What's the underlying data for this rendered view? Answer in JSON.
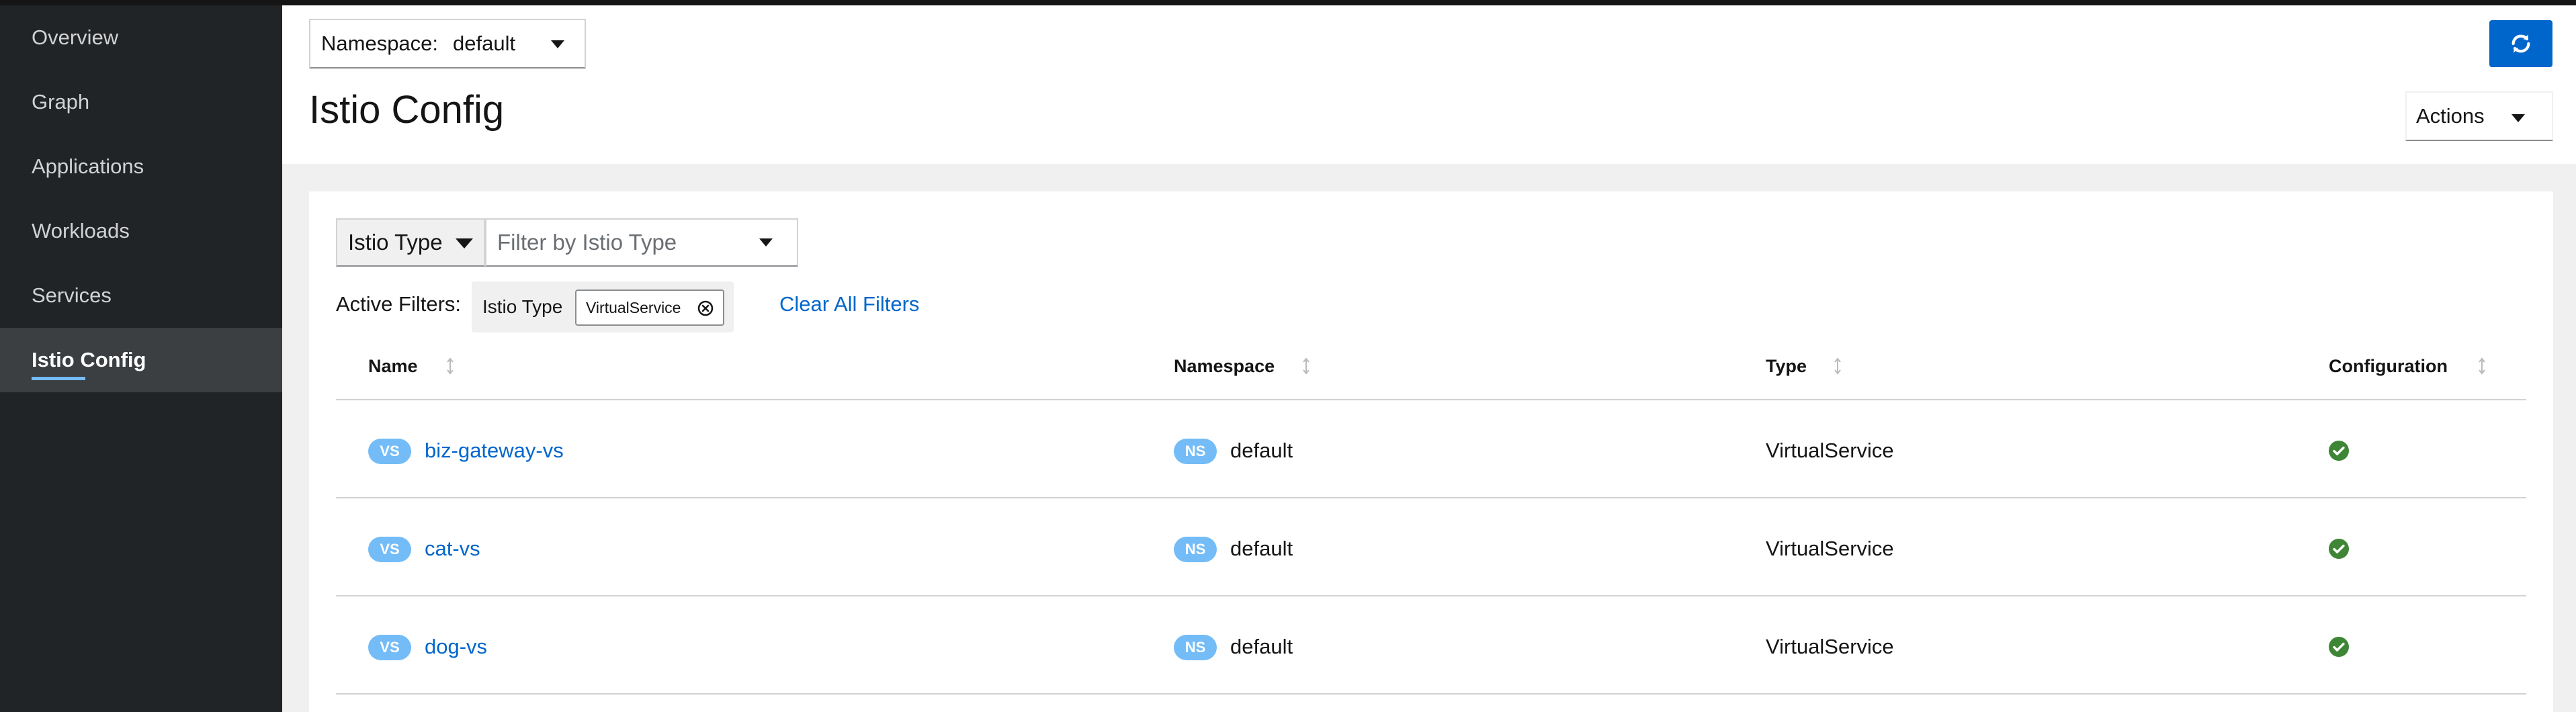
{
  "nav": {
    "items": [
      {
        "label": "Overview"
      },
      {
        "label": "Graph"
      },
      {
        "label": "Applications"
      },
      {
        "label": "Workloads"
      },
      {
        "label": "Services"
      },
      {
        "label": "Istio Config"
      }
    ],
    "active": "Istio Config"
  },
  "header": {
    "namespace_label": "Namespace:",
    "namespace_value": "default",
    "title": "Istio Config",
    "refresh_icon": "refresh-icon",
    "actions_label": "Actions"
  },
  "filters": {
    "type_label": "Istio Type",
    "placeholder": "Filter by Istio Type",
    "active_label": "Active Filters:",
    "chip_category": "Istio Type",
    "chip_value": "VirtualService",
    "clear_label": "Clear All Filters"
  },
  "table": {
    "columns": [
      "Name",
      "Namespace",
      "Type",
      "Configuration"
    ],
    "rows": [
      {
        "badge": "VS",
        "name": "biz-gateway-vs",
        "ns_badge": "NS",
        "namespace": "default",
        "type": "VirtualService",
        "config_status": "valid"
      },
      {
        "badge": "VS",
        "name": "cat-vs",
        "ns_badge": "NS",
        "namespace": "default",
        "type": "VirtualService",
        "config_status": "valid"
      },
      {
        "badge": "VS",
        "name": "dog-vs",
        "ns_badge": "NS",
        "namespace": "default",
        "type": "VirtualService",
        "config_status": "valid"
      }
    ]
  },
  "colors": {
    "accent": "#0066cc",
    "badge": "#73bcf7",
    "success": "#3e8635",
    "sidebar": "#212427"
  }
}
